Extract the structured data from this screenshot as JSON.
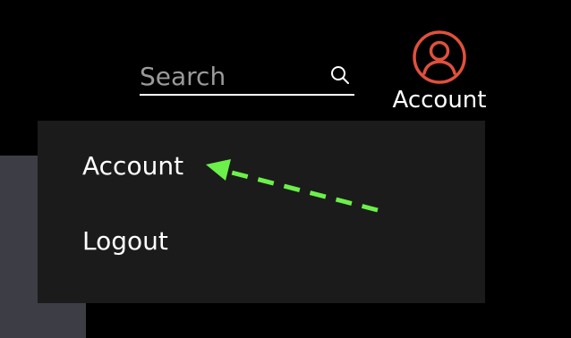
{
  "header": {
    "search": {
      "placeholder": "Search",
      "value": "",
      "icon": "search-icon"
    },
    "account": {
      "label": "Account",
      "icon": "user-circle-icon",
      "icon_color": "#e0513c"
    }
  },
  "dropdown": {
    "items": [
      {
        "label": "Account"
      },
      {
        "label": "Logout"
      }
    ]
  },
  "annotation": {
    "color": "#6cf04a",
    "style": "dashed-arrow"
  }
}
